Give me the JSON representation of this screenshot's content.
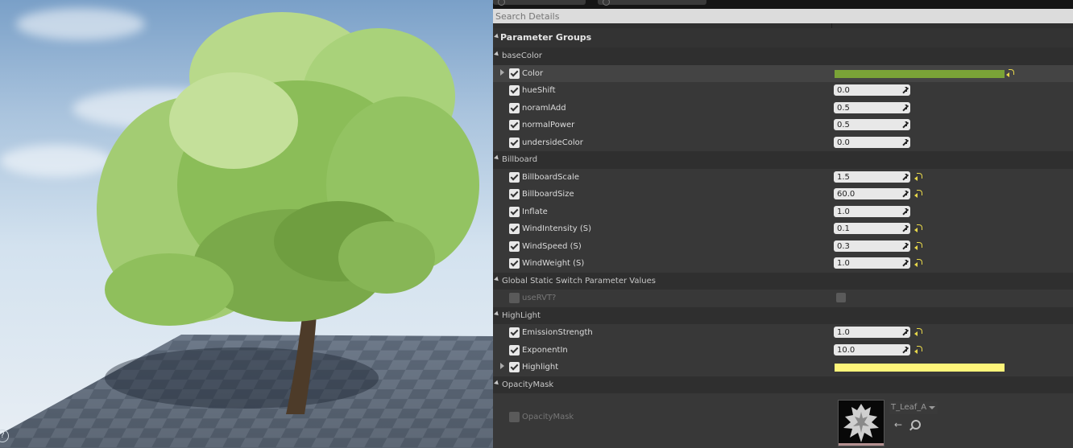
{
  "details": {
    "search_placeholder": "Search Details",
    "section_title": "Parameter Groups"
  },
  "groups": [
    {
      "label": "baseColor",
      "params": [
        {
          "name": "Color",
          "kind": "color",
          "color": "#7aa337",
          "expandable": true,
          "reset": true,
          "highlighted": true
        },
        {
          "name": "hueShift",
          "kind": "number",
          "value": "0.0"
        },
        {
          "name": "noramlAdd",
          "kind": "number",
          "value": "0.5"
        },
        {
          "name": "normalPower",
          "kind": "number",
          "value": "0.5"
        },
        {
          "name": "undersideColor",
          "kind": "number",
          "value": "0.0"
        }
      ]
    },
    {
      "label": "Billboard",
      "params": [
        {
          "name": "BillboardScale",
          "kind": "number",
          "value": "1.5",
          "reset": true
        },
        {
          "name": "BillboardSize",
          "kind": "number",
          "value": "60.0",
          "reset": true
        },
        {
          "name": "Inflate",
          "kind": "number",
          "value": "1.0"
        },
        {
          "name": "WindIntensity (S)",
          "kind": "number",
          "value": "0.1",
          "reset": true
        },
        {
          "name": "WindSpeed (S)",
          "kind": "number",
          "value": "0.3",
          "reset": true
        },
        {
          "name": "WindWeight (S)",
          "kind": "number",
          "value": "1.0",
          "reset": true
        }
      ]
    },
    {
      "label": "Global Static Switch Parameter Values",
      "params": [
        {
          "name": "useRVT?",
          "kind": "switch",
          "enabled": false
        }
      ]
    },
    {
      "label": "HighLight",
      "params": [
        {
          "name": "EmissionStrength",
          "kind": "number",
          "value": "1.0",
          "reset": true
        },
        {
          "name": "ExponentIn",
          "kind": "number",
          "value": "10.0",
          "reset": true
        },
        {
          "name": "Highlight",
          "kind": "color",
          "color": "#fff57a",
          "expandable": true
        }
      ]
    },
    {
      "label": "OpacityMask",
      "params": [
        {
          "name": "OpacityMask",
          "kind": "texture",
          "enabled": false,
          "texture_name": "T_Leaf_A"
        }
      ]
    }
  ],
  "icons": {
    "texture_dropdown": "chevron-down-icon",
    "use_selected": "arrow-left-icon",
    "browse": "search-icon",
    "reset_to_default": "reset-arrow-icon",
    "help": "help-icon"
  },
  "colors": {
    "panel_bg": "#2f2f2f",
    "accent_reset": "#e8d84a"
  }
}
